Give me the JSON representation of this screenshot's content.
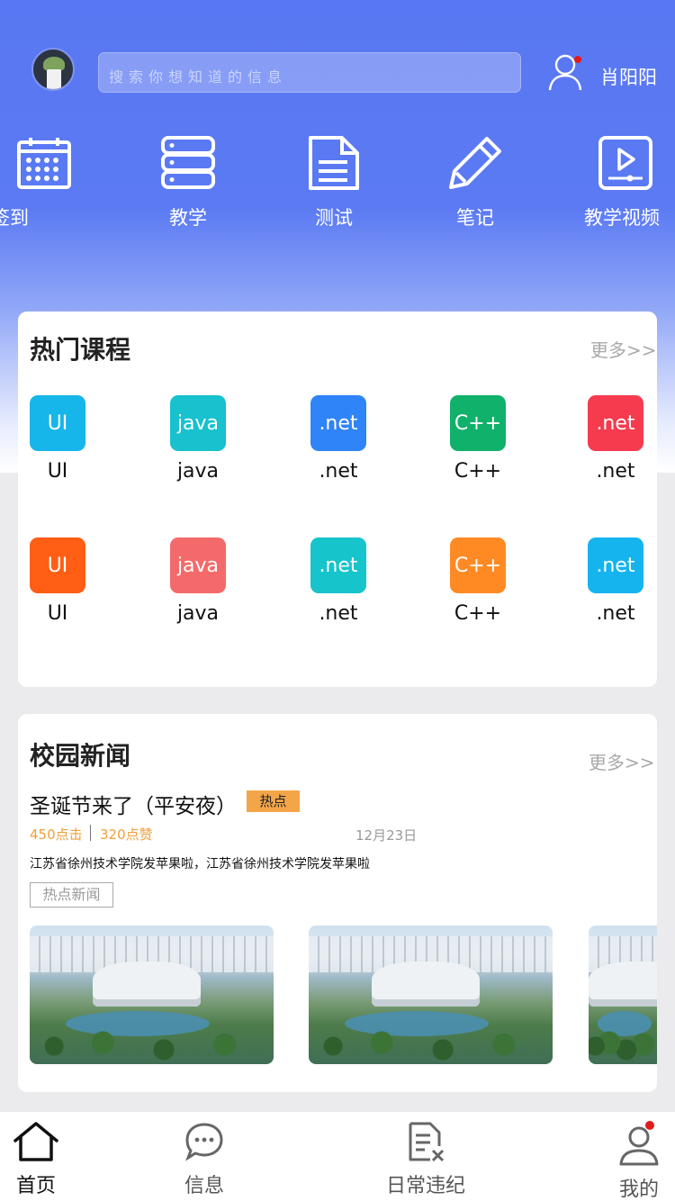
{
  "header": {
    "search_placeholder": "搜索你想知道的信息",
    "user_name": "肖阳阳",
    "avatar_icon": "avatar-image",
    "user_icon": "user-icon",
    "has_notification": true
  },
  "quick_nav": [
    {
      "label": "签到",
      "icon": "calendar-icon"
    },
    {
      "label": "教学",
      "icon": "server-icon"
    },
    {
      "label": "测试",
      "icon": "document-icon"
    },
    {
      "label": "笔记",
      "icon": "pencil-icon"
    },
    {
      "label": "教学视频",
      "icon": "video-icon"
    }
  ],
  "hot_courses": {
    "title": "热门课程",
    "more": "更多>>",
    "items": [
      {
        "tile": "UI",
        "name": "UI",
        "color": "#16b6ea"
      },
      {
        "tile": "java",
        "name": "java",
        "color": "#17c1cd"
      },
      {
        "tile": ".net",
        "name": ".net",
        "color": "#2f84f7"
      },
      {
        "tile": "C++",
        "name": "C++",
        "color": "#10b16b"
      },
      {
        "tile": ".net",
        "name": ".net",
        "color": "#f63b4f"
      },
      {
        "tile": "UI",
        "name": "UI",
        "color": "#ff5e14"
      },
      {
        "tile": "java",
        "name": "java",
        "color": "#f46a6a"
      },
      {
        "tile": ".net",
        "name": ".net",
        "color": "#16c4cc"
      },
      {
        "tile": "C++",
        "name": "C++",
        "color": "#ff8a24"
      },
      {
        "tile": ".net",
        "name": ".net",
        "color": "#15b4ef"
      }
    ]
  },
  "campus_news": {
    "title": "校园新闻",
    "more": "更多>>",
    "item": {
      "headline": "圣诞节来了（平安夜）",
      "badge": "热点",
      "clicks": "450点击",
      "likes": "320点赞",
      "date": "12月23日",
      "summary": "江苏省徐州技术学院发苹果啦，江苏省徐州技术学院发苹果啦",
      "tag": "热点新闻"
    }
  },
  "tabbar": [
    {
      "label": "首页",
      "icon": "home-icon",
      "active": true
    },
    {
      "label": "信息",
      "icon": "chat-bubble-icon",
      "active": false
    },
    {
      "label": "日常违纪",
      "icon": "violation-document-icon",
      "active": false
    },
    {
      "label": "我的",
      "icon": "profile-icon",
      "active": false
    }
  ],
  "colors": {
    "primary": "#5877f2",
    "accent_orange": "#f0a03d",
    "notification": "#e21b1b"
  }
}
